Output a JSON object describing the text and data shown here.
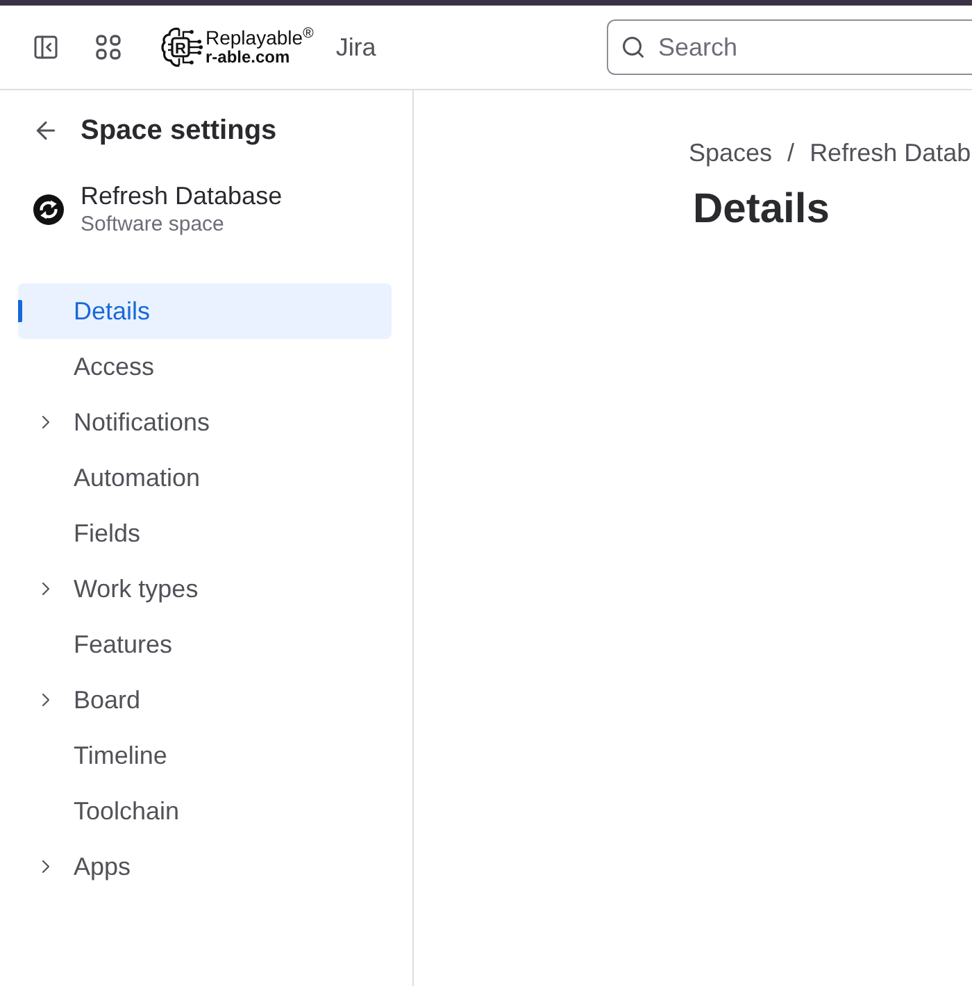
{
  "top_nav": {
    "logo": {
      "mark_letter": "R",
      "name": "Replayable$^{®}$",
      "domain": "r-able.com"
    },
    "product": "Jira",
    "search": {
      "placeholder": "Search"
    }
  },
  "sidebar": {
    "title": "Space settings",
    "space": {
      "name": "Refresh Database",
      "type": "Software space"
    },
    "items": [
      {
        "label": "Details",
        "selected": true,
        "expandable": false
      },
      {
        "label": "Access",
        "selected": false,
        "expandable": false
      },
      {
        "label": "Notifications",
        "selected": false,
        "expandable": true
      },
      {
        "label": "Automation",
        "selected": false,
        "expandable": false
      },
      {
        "label": "Fields",
        "selected": false,
        "expandable": false
      },
      {
        "label": "Work types",
        "selected": false,
        "expandable": true
      },
      {
        "label": "Features",
        "selected": false,
        "expandable": false
      },
      {
        "label": "Board",
        "selected": false,
        "expandable": true
      },
      {
        "label": "Timeline",
        "selected": false,
        "expandable": false
      },
      {
        "label": "Toolchain",
        "selected": false,
        "expandable": false
      },
      {
        "label": "Apps",
        "selected": false,
        "expandable": true
      }
    ]
  },
  "main": {
    "breadcrumbs": [
      {
        "label": "Spaces"
      },
      {
        "label": "Refresh Datab"
      }
    ],
    "breadcrumb_separator": "/",
    "heading": "Details"
  }
}
